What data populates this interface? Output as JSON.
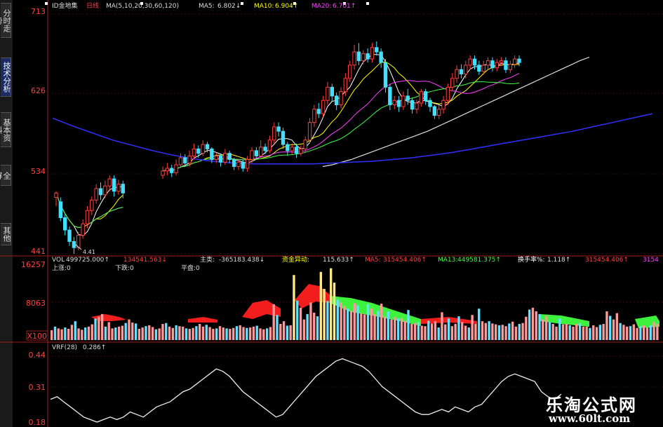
{
  "tabs": [
    "分时走势",
    "技术分析",
    "基本资料",
    "全屏",
    "其他"
  ],
  "active_tab": 1,
  "header": {
    "stock": "ID金地集",
    "period": "日线",
    "ma_params": "MA(5,10,20,30,60,120)",
    "ma5_label": "MA5:",
    "ma5_value": "6.802↓",
    "ma10_label": "MA10:",
    "ma10_value": "6.904↑",
    "ma20_label": "MA20:",
    "ma20_value": "6.701↑"
  },
  "volume_header": {
    "vol_label": "VOL",
    "vol_value": "499725.000↑",
    "item2": "134541.563↓",
    "zhuli_label": "主类:",
    "zhuli_value": "-365183.438↓",
    "zijin_label": "资金异动:",
    "zijin_value": "115.633↑",
    "ma5_label": "MA5:",
    "ma5_value": "315454.406↑",
    "ma13_label": "MA13:",
    "ma13_value": "449581.375↑",
    "hsl_label": "换手率%:",
    "hsl_value": "1.118↑",
    "tail1": "315454.406↑",
    "tail2": "3154",
    "row2_a": "上涨:0",
    "row2_b": "下跌:0",
    "row2_c": "平盘:0"
  },
  "vrf_header": {
    "label": "VRF(28)",
    "value": "0.286↑"
  },
  "watermark": {
    "text": "乐淘公式网",
    "url": "www.60lt.com"
  },
  "colors": {
    "up": "#ff4040",
    "down": "#40e0ff",
    "ma5": "#ffffff",
    "ma10": "#ffff00",
    "ma20": "#ff40ff",
    "ma30": "#40ff40",
    "ma60": "#dddddd",
    "ma120": "#3030ff",
    "flag": "#ff2020"
  },
  "chart_data": [
    {
      "type": "candlestick",
      "title": "",
      "yticks": [
        "713",
        "626",
        "534",
        "441"
      ],
      "ylim": [
        4.41,
        7.13
      ],
      "low_annotation": "4.41",
      "candles": [
        [
          5.05,
          5.1,
          4.95,
          5.12
        ],
        [
          5.0,
          4.82,
          4.78,
          5.05
        ],
        [
          4.82,
          4.68,
          4.62,
          4.86
        ],
        [
          4.68,
          4.55,
          4.5,
          4.72
        ],
        [
          4.55,
          4.48,
          4.41,
          4.6
        ],
        [
          4.48,
          4.62,
          4.45,
          4.66
        ],
        [
          4.62,
          4.75,
          4.58,
          4.8
        ],
        [
          4.75,
          4.9,
          4.7,
          4.95
        ],
        [
          4.9,
          5.02,
          4.85,
          5.06
        ],
        [
          5.02,
          5.15,
          4.98,
          5.2
        ],
        [
          5.15,
          5.08,
          5.02,
          5.22
        ],
        [
          5.08,
          5.18,
          5.04,
          5.24
        ],
        [
          5.18,
          5.26,
          5.12,
          5.3
        ],
        [
          5.26,
          5.12,
          5.06,
          5.3
        ],
        [
          5.12,
          5.2,
          5.08,
          5.25
        ],
        [
          5.2,
          5.1,
          5.04,
          5.24
        ],
        [
          5.3,
          5.35,
          5.26,
          5.4
        ],
        [
          5.35,
          5.38,
          5.3,
          5.44
        ],
        [
          5.38,
          5.33,
          5.28,
          5.42
        ],
        [
          5.33,
          5.42,
          5.3,
          5.48
        ],
        [
          5.42,
          5.5,
          5.38,
          5.55
        ],
        [
          5.5,
          5.44,
          5.4,
          5.54
        ],
        [
          5.44,
          5.52,
          5.4,
          5.58
        ],
        [
          5.52,
          5.6,
          5.48,
          5.66
        ],
        [
          5.6,
          5.55,
          5.5,
          5.64
        ],
        [
          5.55,
          5.65,
          5.52,
          5.7
        ],
        [
          5.65,
          5.6,
          5.56,
          5.68
        ],
        [
          5.6,
          5.48,
          5.44,
          5.62
        ],
        [
          5.48,
          5.52,
          5.44,
          5.56
        ],
        [
          5.52,
          5.45,
          5.4,
          5.55
        ],
        [
          5.45,
          5.55,
          5.42,
          5.6
        ],
        [
          5.55,
          5.48,
          5.44,
          5.58
        ],
        [
          5.48,
          5.4,
          5.36,
          5.5
        ],
        [
          5.4,
          5.45,
          5.36,
          5.48
        ],
        [
          5.45,
          5.38,
          5.34,
          5.48
        ],
        [
          5.38,
          5.48,
          5.34,
          5.52
        ],
        [
          5.48,
          5.58,
          5.44,
          5.62
        ],
        [
          5.58,
          5.52,
          5.48,
          5.62
        ],
        [
          5.52,
          5.62,
          5.5,
          5.7
        ],
        [
          5.62,
          5.58,
          5.54,
          5.66
        ],
        [
          5.58,
          5.7,
          5.55,
          5.75
        ],
        [
          5.7,
          5.85,
          5.66,
          5.9
        ],
        [
          5.85,
          5.8,
          5.74,
          5.9
        ],
        [
          5.8,
          5.65,
          5.6,
          5.84
        ],
        [
          5.65,
          5.58,
          5.52,
          5.68
        ],
        [
          5.58,
          5.62,
          5.54,
          5.66
        ],
        [
          5.62,
          5.55,
          5.5,
          5.66
        ],
        [
          5.55,
          5.6,
          5.52,
          5.64
        ],
        [
          5.6,
          5.7,
          5.56,
          5.74
        ],
        [
          5.7,
          5.9,
          5.66,
          5.95
        ],
        [
          5.9,
          6.05,
          5.85,
          6.1
        ],
        [
          6.05,
          6.0,
          5.95,
          6.12
        ],
        [
          6.0,
          6.15,
          5.96,
          6.2
        ],
        [
          6.15,
          6.3,
          6.1,
          6.36
        ],
        [
          6.3,
          6.2,
          6.14,
          6.34
        ],
        [
          6.2,
          6.1,
          6.04,
          6.24
        ],
        [
          6.1,
          6.25,
          6.06,
          6.3
        ],
        [
          6.25,
          6.4,
          6.2,
          6.46
        ],
        [
          6.4,
          6.55,
          6.36,
          6.6
        ],
        [
          6.55,
          6.7,
          6.5,
          6.78
        ],
        [
          6.7,
          6.6,
          6.55,
          6.8
        ],
        [
          6.6,
          6.68,
          6.56,
          6.72
        ],
        [
          6.68,
          6.62,
          6.58,
          6.74
        ],
        [
          6.62,
          6.75,
          6.58,
          6.8
        ],
        [
          6.75,
          6.7,
          6.66,
          6.82
        ],
        [
          6.7,
          6.58,
          6.52,
          6.74
        ],
        [
          6.58,
          6.3,
          6.24,
          6.62
        ],
        [
          6.3,
          6.1,
          6.04,
          6.34
        ],
        [
          6.1,
          6.15,
          6.05,
          6.2
        ],
        [
          6.15,
          6.08,
          6.02,
          6.2
        ],
        [
          6.08,
          6.2,
          6.04,
          6.25
        ],
        [
          6.2,
          6.15,
          6.1,
          6.28
        ],
        [
          6.15,
          6.05,
          6.0,
          6.18
        ],
        [
          6.05,
          6.12,
          6.0,
          6.16
        ],
        [
          6.12,
          6.25,
          6.08,
          6.28
        ],
        [
          6.25,
          6.15,
          6.1,
          6.28
        ],
        [
          6.15,
          6.08,
          6.02,
          6.18
        ],
        [
          6.08,
          5.98,
          5.94,
          6.1
        ],
        [
          5.98,
          6.05,
          5.94,
          6.1
        ],
        [
          6.05,
          6.15,
          6.0,
          6.2
        ],
        [
          6.15,
          6.3,
          6.1,
          6.34
        ],
        [
          6.3,
          6.4,
          6.26,
          6.46
        ],
        [
          6.4,
          6.5,
          6.35,
          6.55
        ],
        [
          6.5,
          6.45,
          6.4,
          6.56
        ],
        [
          6.45,
          6.55,
          6.4,
          6.6
        ],
        [
          6.55,
          6.62,
          6.5,
          6.66
        ],
        [
          6.62,
          6.55,
          6.5,
          6.66
        ],
        [
          6.55,
          6.48,
          6.44,
          6.6
        ],
        [
          6.48,
          6.55,
          6.44,
          6.6
        ],
        [
          6.55,
          6.6,
          6.5,
          6.64
        ],
        [
          6.6,
          6.52,
          6.48,
          6.64
        ],
        [
          6.52,
          6.58,
          6.48,
          6.62
        ],
        [
          6.58,
          6.6,
          6.54,
          6.64
        ],
        [
          6.6,
          6.5,
          6.46,
          6.64
        ],
        [
          6.5,
          6.56,
          6.46,
          6.6
        ],
        [
          6.56,
          6.62,
          6.52,
          6.66
        ],
        [
          6.62,
          6.58,
          6.54,
          6.66
        ]
      ],
      "ma": {
        "ma60": [
          5.4,
          5.42,
          5.45,
          5.48,
          5.52,
          5.56,
          5.6,
          5.64,
          5.68,
          5.72,
          5.76,
          5.8,
          5.85,
          5.9,
          5.95,
          6.0,
          6.05,
          6.1,
          6.15,
          6.2,
          6.25,
          6.3,
          6.35,
          6.4,
          6.45,
          6.5,
          6.55,
          6.6,
          6.64
        ],
        "ma120": [
          5.95,
          5.86,
          5.78,
          5.7,
          5.64,
          5.58,
          5.53,
          5.49,
          5.46,
          5.44,
          5.43,
          5.43,
          5.43,
          5.43,
          5.44,
          5.45,
          5.46,
          5.48,
          5.5,
          5.53,
          5.56,
          5.6,
          5.64,
          5.68,
          5.72,
          5.76,
          5.8,
          5.85,
          5.9,
          5.95,
          6.0
        ]
      }
    },
    {
      "type": "bar",
      "title": "",
      "yticks": [
        "16257",
        "8063",
        "X100"
      ],
      "ylim": [
        0,
        16257
      ],
      "values": [
        2200,
        3000,
        2600,
        2400,
        2800,
        2500,
        3400,
        4200,
        2600,
        2300,
        2800,
        3000,
        3500,
        4800,
        5200,
        5800,
        3000,
        4000,
        2600,
        2800,
        3000,
        3200,
        3800,
        4600,
        3900,
        3700,
        2500,
        2800,
        3100,
        3300,
        2900,
        2400,
        2600,
        3600,
        3800,
        3000,
        2700,
        3300,
        3100,
        3000,
        2600,
        2500,
        2700,
        3100,
        3600,
        3000,
        3400,
        2900,
        2500,
        2600,
        3100,
        2800,
        2600,
        2500,
        2700,
        3100,
        3300,
        2900,
        2700,
        2800,
        3000,
        3200,
        2600,
        2400,
        2600,
        2900,
        8000,
        5600,
        3600,
        4200,
        3200,
        3300,
        14500,
        8800,
        7200,
        4600,
        5800,
        8400,
        6100,
        5300,
        15200,
        11400,
        8700,
        16000,
        12800,
        9000,
        8400,
        7600,
        7000,
        6500,
        8200,
        7700,
        6000,
        5700,
        8000,
        7000,
        5800,
        6500,
        8100,
        5300,
        6400,
        4600,
        5200,
        4800,
        4900,
        4300,
        6700,
        3600,
        3800,
        4000,
        3200,
        3100,
        4300,
        3700,
        4200,
        2800,
        6200,
        3500,
        4800,
        3100,
        3600,
        5300,
        4000,
        3200,
        2800,
        5600,
        3600,
        7000,
        4200,
        3800,
        4200,
        3700,
        3500,
        3300,
        3400,
        3100,
        3700,
        4100,
        3000,
        3600,
        3800,
        5200,
        6800,
        7200,
        6400,
        5800,
        4600,
        5400,
        4000,
        3600,
        3000,
        4800,
        3500,
        3600,
        3300,
        3000,
        3600,
        3800,
        3000,
        3000,
        2700,
        3300,
        2900,
        3400,
        3600,
        6400,
        5400,
        4600,
        6000,
        3800,
        3400,
        3000,
        3100,
        3500,
        2700,
        3100,
        3300,
        2800,
        3300,
        4000,
        3600
      ]
    },
    {
      "type": "line",
      "title": "",
      "yticks": [
        "0.44",
        "0.31",
        "0.18"
      ],
      "ylim": [
        0.18,
        0.44
      ],
      "values": [
        0.27,
        0.28,
        0.26,
        0.24,
        0.22,
        0.2,
        0.19,
        0.18,
        0.19,
        0.2,
        0.19,
        0.2,
        0.22,
        0.21,
        0.2,
        0.22,
        0.24,
        0.25,
        0.26,
        0.28,
        0.3,
        0.31,
        0.33,
        0.35,
        0.37,
        0.39,
        0.38,
        0.36,
        0.33,
        0.3,
        0.28,
        0.26,
        0.24,
        0.22,
        0.2,
        0.21,
        0.24,
        0.27,
        0.3,
        0.33,
        0.36,
        0.38,
        0.4,
        0.42,
        0.43,
        0.42,
        0.41,
        0.4,
        0.38,
        0.35,
        0.32,
        0.3,
        0.28,
        0.26,
        0.24,
        0.22,
        0.21,
        0.21,
        0.22,
        0.23,
        0.22,
        0.24,
        0.23,
        0.22,
        0.24,
        0.25,
        0.28,
        0.31,
        0.34,
        0.36,
        0.37,
        0.36,
        0.35,
        0.34,
        0.3,
        0.28,
        0.27,
        0.29
      ]
    }
  ]
}
